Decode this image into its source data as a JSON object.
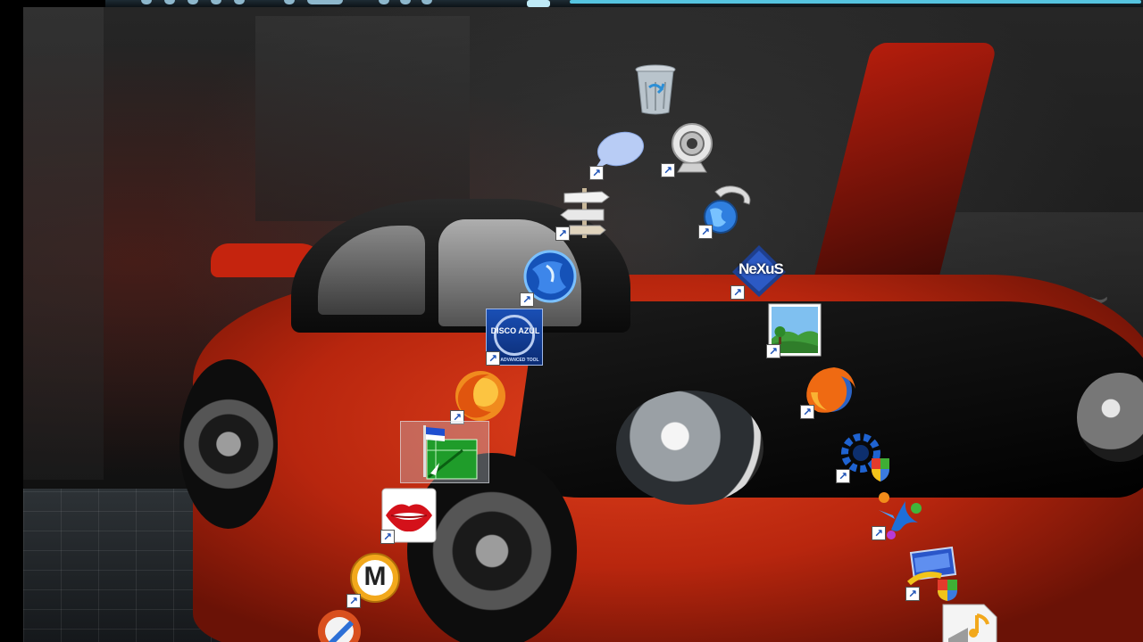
{
  "desktop": {
    "icons": [
      {
        "id": "recycle-bin",
        "icon": "recycle-bin-icon",
        "shortcut": false
      },
      {
        "id": "speech-bubble",
        "icon": "speech-bubble-icon",
        "shortcut": true
      },
      {
        "id": "webcam",
        "icon": "webcam-icon",
        "shortcut": true
      },
      {
        "id": "signpost",
        "icon": "signpost-icon",
        "shortcut": true
      },
      {
        "id": "phone-globe",
        "icon": "phone-globe-icon",
        "shortcut": true
      },
      {
        "id": "blue-globe",
        "icon": "blue-globe-icon",
        "shortcut": true
      },
      {
        "id": "nexus",
        "icon": "nexus-icon",
        "label": "NeXuS",
        "shortcut": true
      },
      {
        "id": "disco-azul",
        "icon": "disco-azul-icon",
        "label": "DISCO AZUL",
        "sublabel": "ADVANCED TOOL",
        "shortcut": true
      },
      {
        "id": "picture-viewer",
        "icon": "landscape-picture-icon",
        "shortcut": true
      },
      {
        "id": "firefox-ball",
        "icon": "firefox-logo-icon",
        "shortcut": true
      },
      {
        "id": "firefox",
        "icon": "firefox-logo-icon",
        "shortcut": true
      },
      {
        "id": "flag-window",
        "icon": "flag-window-icon",
        "shortcut": false
      },
      {
        "id": "system-tool",
        "icon": "gear-shield-icon",
        "shortcut": true
      },
      {
        "id": "lips",
        "icon": "lips-icon",
        "shortcut": true
      },
      {
        "id": "dancer",
        "icon": "dancer-icon",
        "shortcut": true
      },
      {
        "id": "megaupload",
        "icon": "megaupload-icon",
        "label": "M",
        "shortcut": true
      },
      {
        "id": "network-settings",
        "icon": "monitor-shield-icon",
        "shortcut": true
      },
      {
        "id": "broom-tool",
        "icon": "broom-icon",
        "shortcut": false
      },
      {
        "id": "music-file",
        "icon": "music-note-icon",
        "shortcut": false
      }
    ]
  },
  "colors": {
    "shortcut_arrow": "#1a4fb5",
    "car_red": "#c5240e",
    "taskbar_accent": "#55c4e0"
  }
}
